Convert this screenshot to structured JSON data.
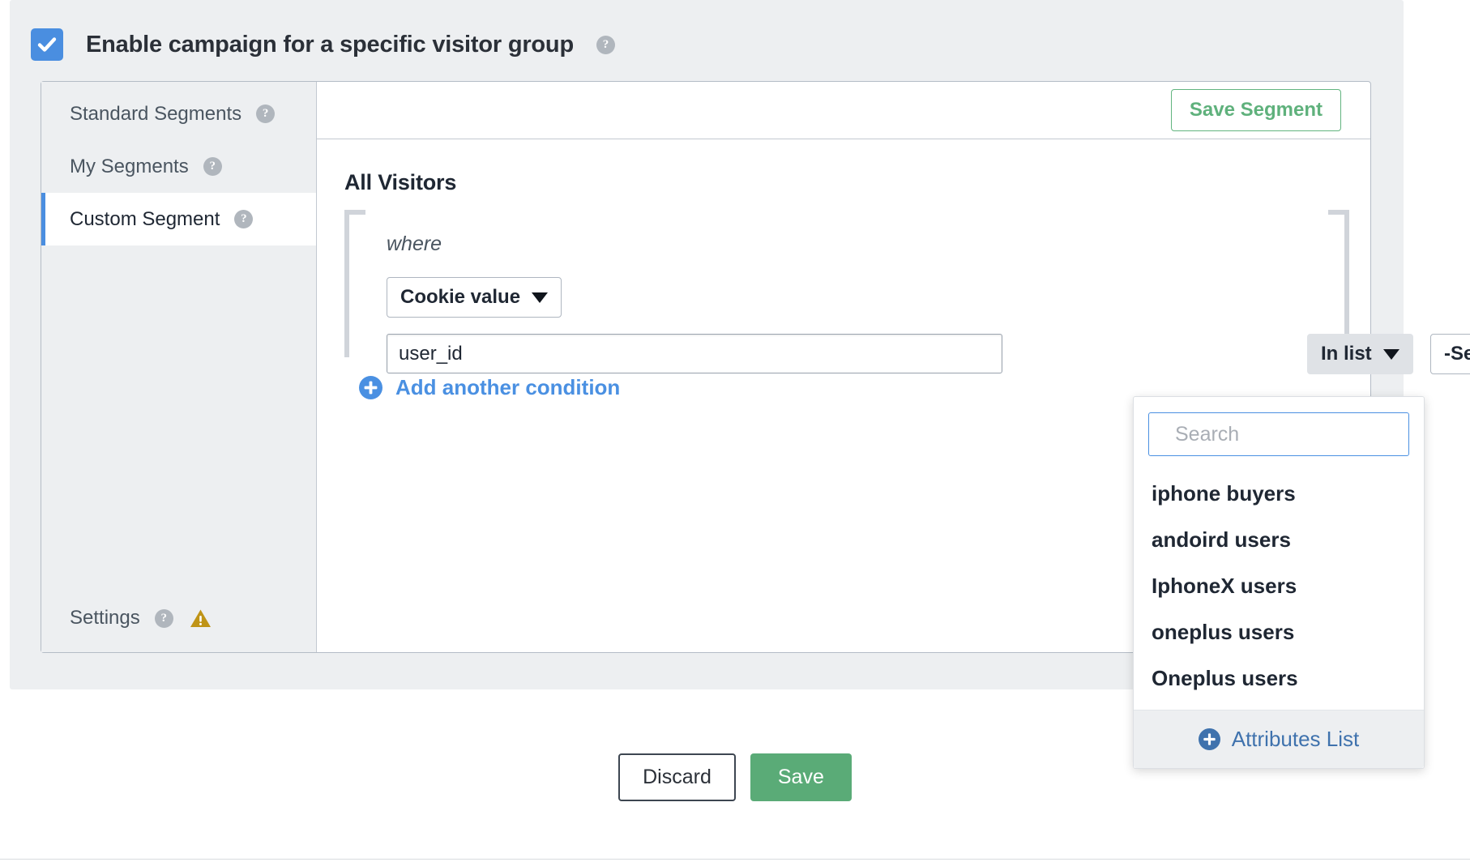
{
  "header": {
    "checkbox_label": "Enable campaign for a specific visitor group",
    "checkbox_checked": true,
    "help_glyph": "?"
  },
  "sidebar": {
    "items": [
      {
        "label": "Standard Segments",
        "active": false,
        "help_glyph": "?"
      },
      {
        "label": "My Segments",
        "active": false,
        "help_glyph": "?"
      },
      {
        "label": "Custom Segment",
        "active": true,
        "help_glyph": "?"
      }
    ],
    "settings": {
      "label": "Settings",
      "help_glyph": "?",
      "warning_icon": "warning-triangle-icon"
    }
  },
  "content": {
    "save_segment_label": "Save Segment",
    "group_title": "All Visitors",
    "where_label": "where",
    "attribute_dropdown_label": "Cookie value",
    "value_input": "user_id",
    "value_input_placeholder": "",
    "operator_dropdown_label": "In list",
    "list_dropdown_label": "-Select-",
    "duplicate_icon": "duplicate-condition-icon",
    "add_condition_label": "Add another condition",
    "add_condition_icon": "plus-circle-icon"
  },
  "attributes_dropdown": {
    "search_placeholder": "Search",
    "search_value": "",
    "search_icon": "search-icon",
    "options": [
      "iphone buyers",
      "andoird users",
      "IphoneX users",
      "oneplus users",
      "Oneplus users"
    ],
    "footer_label": "Attributes List",
    "footer_icon": "plus-circle-icon"
  },
  "footer": {
    "discard_label": "Discard",
    "save_label": "Save"
  },
  "colors": {
    "checkbox_blue": "#4a8ee0",
    "accent_blue": "#4a90e2",
    "link_blue": "#3f72ad",
    "green_save": "#5aab77",
    "green_outline": "#62b47f",
    "panel_gray": "#edeff1",
    "warning_gold": "#bf9417",
    "text_dark": "#1f2733"
  }
}
